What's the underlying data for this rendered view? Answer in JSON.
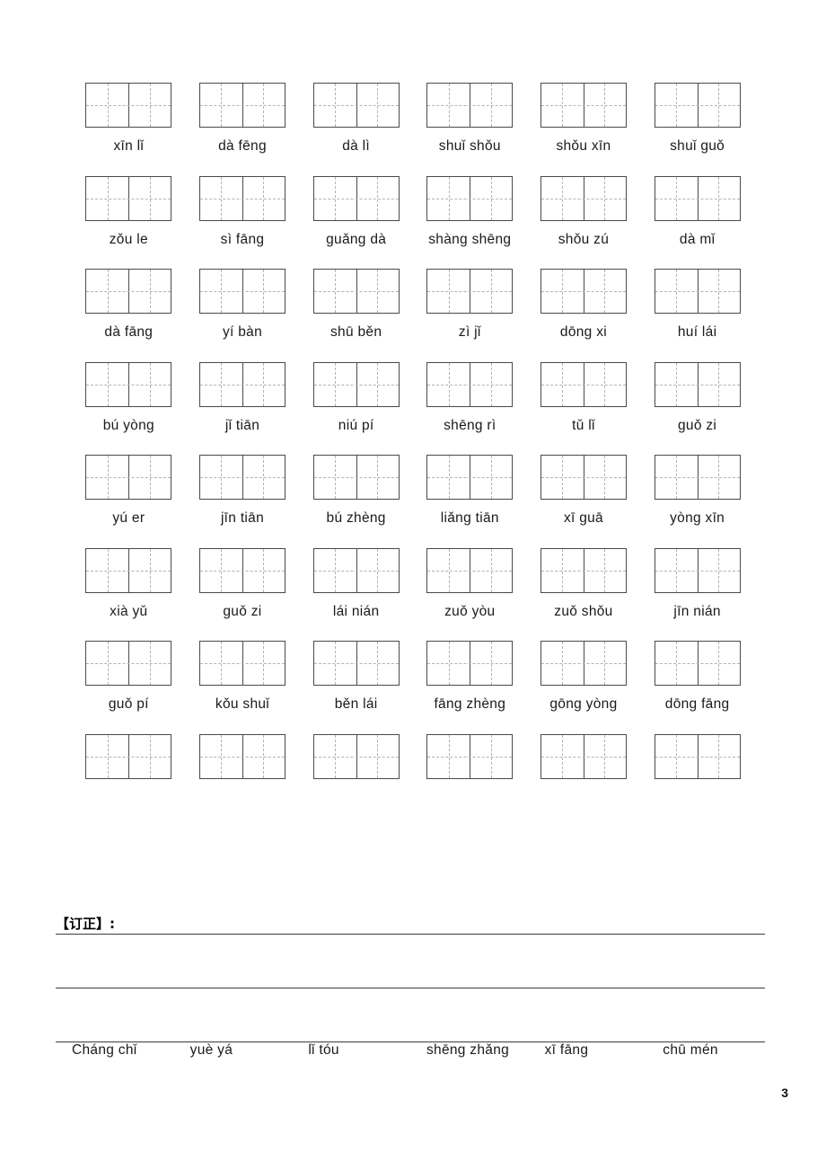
{
  "page": {
    "page_number": "3"
  },
  "worksheet": {
    "rows": [
      {
        "labels": [
          "xīn  lǐ",
          "dà  fēng",
          "dà  lì",
          "shuǐ  shǒu",
          "shǒu  xīn",
          "shuǐ guǒ"
        ]
      },
      {
        "labels": [
          "zǒu  le",
          "sì   fāng",
          "guǎng dà",
          "shàng shēng",
          "shǒu  zú",
          "dà  mǐ"
        ]
      },
      {
        "labels": [
          "dà   fāng",
          "yí  bàn",
          "shū běn",
          "zì    jǐ",
          "dōng xi",
          "huí lái"
        ]
      },
      {
        "labels": [
          "bú  yòng",
          "jǐ  tiān",
          "niú  pí",
          "shēng  rì",
          "tǔ  lǐ",
          "guǒ zi"
        ]
      },
      {
        "labels": [
          "yú   er",
          "jīn tiān",
          "bú zhèng",
          "liǎng  tiān",
          "xī guā",
          "yòng   xīn"
        ]
      },
      {
        "labels": [
          "xià  yǔ",
          "guǒ zi",
          "lái nián",
          "zuǒ  yòu",
          "zuǒ  shǒu",
          "jīn nián"
        ]
      },
      {
        "labels": [
          "guǒ   pí",
          "kǒu  shuǐ",
          "běn  lái",
          "fāng zhèng",
          "gōng  yòng",
          "dōng fāng"
        ]
      }
    ],
    "trailing_grid_row": true
  },
  "correction": {
    "label": "【订正】:"
  },
  "bottom_pinyin": {
    "items": [
      "Cháng  chǐ",
      "yuè  yá",
      "lǐ tóu",
      "shēng zhǎng",
      "xī  fāng",
      "chū  mén"
    ]
  }
}
